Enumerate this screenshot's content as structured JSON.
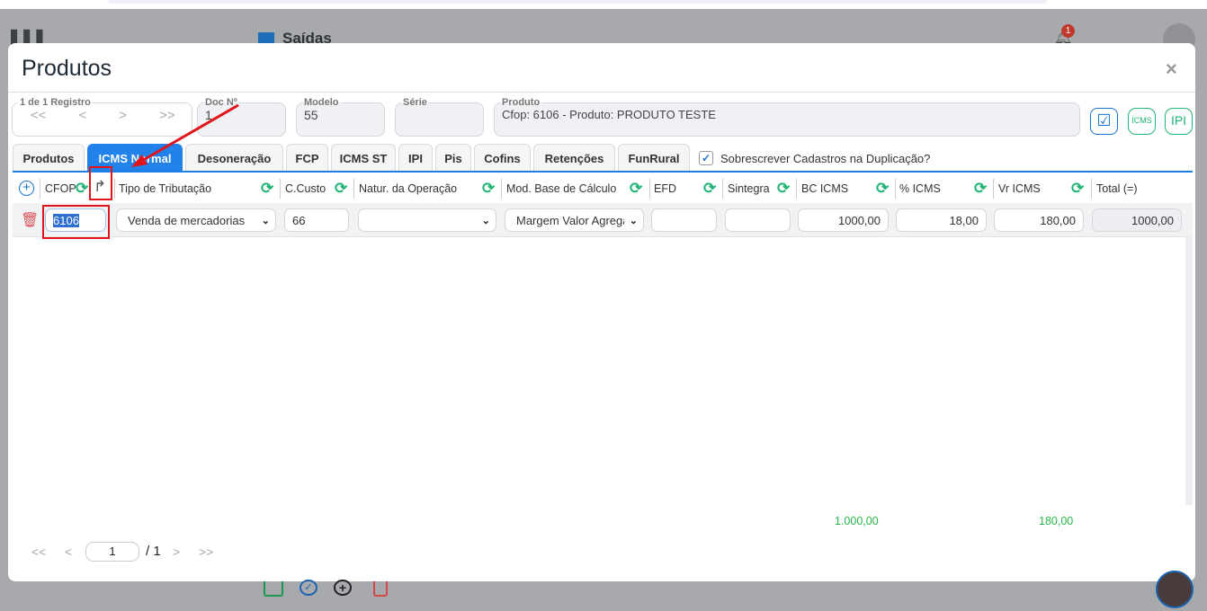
{
  "background_app": {
    "module_title": "Saídas",
    "notification_count": "1"
  },
  "modal": {
    "title": "Produtos",
    "close_label": "×",
    "registro": {
      "label": "1 de 1 Registro",
      "first": "<<",
      "prev": "<",
      "next": ">",
      "last": ">>"
    },
    "fields": {
      "doc": {
        "label": "Doc Nº",
        "value": "1"
      },
      "modelo": {
        "label": "Modelo",
        "value": "55"
      },
      "serie": {
        "label": "Série",
        "value": ""
      },
      "produto": {
        "label": "Produto",
        "value": "Cfop: 6106 - Produto: PRODUTO TESTE"
      }
    },
    "action_buttons": {
      "icms": "ICMS",
      "ipi": "IPI"
    },
    "tabs": [
      "Produtos",
      "ICMS Normal",
      "Desoneração",
      "FCP",
      "ICMS ST",
      "IPI",
      "Pis",
      "Cofins",
      "Retenções",
      "FunRural"
    ],
    "active_tab": "ICMS Normal",
    "overwrite_checkbox": {
      "label": "Sobrescrever Cadastros na Duplicação?",
      "checked": true
    },
    "columns": [
      "CFOP",
      "Tipo de Tributação",
      "C.Custo",
      "Natur. da Operação",
      "Mod. Base de Cálculo",
      "EFD",
      "Sintegra",
      "BC ICMS",
      "% ICMS",
      "Vr ICMS",
      "Total (=)"
    ],
    "row": {
      "cfop": "6106",
      "tipo_tributacao": "Venda de mercadorias",
      "c_custo": "66",
      "natur_operacao": "",
      "mod_base": "Margem Valor Agregado",
      "efd": "",
      "sintegra": "",
      "bc_icms": "1000,00",
      "pct_icms": "18,00",
      "vr_icms": "180,00",
      "total": "1000,00"
    },
    "totals": {
      "bc_icms": "1.000,00",
      "vr_icms": "180,00"
    },
    "pagination": {
      "first": "<<",
      "prev": "<",
      "page": "1",
      "of": "/ 1",
      "next": ">",
      "last": ">>"
    }
  },
  "colors": {
    "accent": "#2382e9",
    "green": "#22b573",
    "annotation": "#e1141b"
  }
}
